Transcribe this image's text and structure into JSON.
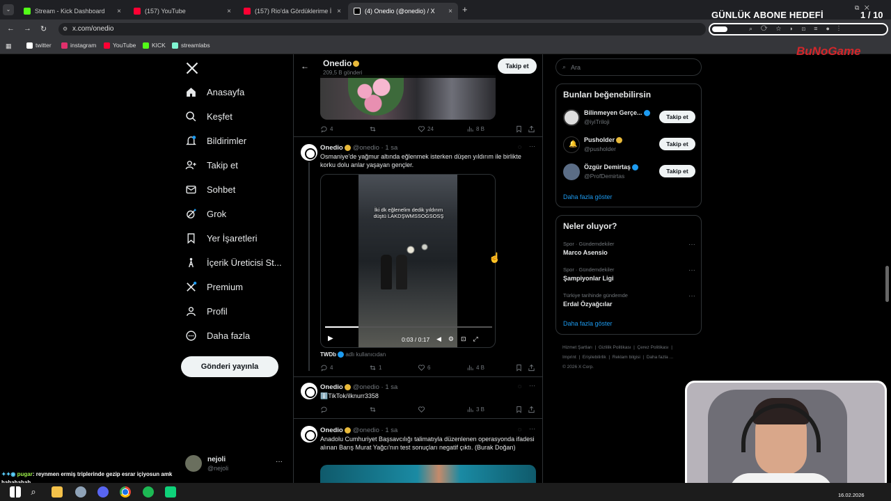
{
  "browser": {
    "tabs": [
      {
        "label": "Stream - Kick Dashboard",
        "color": "#53fc18"
      },
      {
        "label": "(157) YouTube",
        "color": "#ff0033"
      },
      {
        "label": "(157) Rio'da Gördüklerime İnan",
        "color": "#ff0033"
      },
      {
        "label": "(4) Onedio (@onedio) / X",
        "color": "#ffffff"
      }
    ],
    "url": "x.com/onedio",
    "bookmarks": [
      {
        "label": "twitter",
        "color": "#ffffff"
      },
      {
        "label": "instagram",
        "color": "#e1306c"
      },
      {
        "label": "YouTube",
        "color": "#ff0033"
      },
      {
        "label": "KICK",
        "color": "#53fc18"
      },
      {
        "label": "streamlabs",
        "color": "#80f5d2"
      }
    ]
  },
  "overlay": {
    "abone_label": "GÜNLÜK ABONE HEDEFİ",
    "abone_count": "1 / 10",
    "brand": "BuNoGame"
  },
  "leftnav": {
    "items": [
      {
        "label": "Anasayfa",
        "icon": "home-icon"
      },
      {
        "label": "Keşfet",
        "icon": "search-icon"
      },
      {
        "label": "Bildirimler",
        "icon": "bell-icon"
      },
      {
        "label": "Takip et",
        "icon": "follow-icon"
      },
      {
        "label": "Sohbet",
        "icon": "mail-icon"
      },
      {
        "label": "Grok",
        "icon": "grok-icon"
      },
      {
        "label": "Yer İşaretleri",
        "icon": "bookmark-icon"
      },
      {
        "label": "İçerik Üreticisi St...",
        "icon": "creator-icon"
      },
      {
        "label": "Premium",
        "icon": "x-premium-icon"
      },
      {
        "label": "Profil",
        "icon": "person-icon"
      },
      {
        "label": "Daha fazla",
        "icon": "more-circle-icon"
      }
    ],
    "post_button": "Gönderi yayınla",
    "profile_name": "nejoli",
    "profile_handle": "@nejoli"
  },
  "feed": {
    "header_name": "Onedio",
    "header_sub": "209,5 B gönderi",
    "follow_label": "Takip et",
    "top_actions": {
      "reply": "4",
      "like": "24",
      "views": "8 B"
    },
    "tweets": [
      {
        "name": "Onedio",
        "meta": "@onedio · 1 sa",
        "text": "Osmaniye'de yağmur altında eğlenmek isterken düşen yıldırım ile birlikte korku dolu anlar yaşayan gençler.",
        "video_caption": "İki dk eğlenelim dedik yıldırım düştü LAKDŞWMSSOGSOSŞ",
        "video_time": "0:03 / 0:17",
        "credit_name": "TWDb",
        "credit_sub": "adlı kullanıcıdan",
        "reply": "4",
        "retweet": "1",
        "like": "6",
        "views": "4 B"
      },
      {
        "name": "Onedio",
        "meta": "@onedio · 1 sa",
        "text": "ℹ️TikTok/ilknurr3358",
        "reply": "",
        "retweet": "",
        "like": "",
        "views": "3 B"
      },
      {
        "name": "Onedio",
        "meta": "@onedio · 1 sa",
        "text": "Anadolu Cumhuriyet Başsavcılığı talimatıyla düzenlenen operasyonda ifadesi alınan Barış Murat Yağcı'nın test sonuçları negatif çıktı. (Burak Doğan)"
      }
    ]
  },
  "right": {
    "search_placeholder": "Ara",
    "who_title": "Bunları beğenebilirsin",
    "who": [
      {
        "name": "Bilinmeyen Gerçe...",
        "handle": "@iyiTriloji",
        "badge": "blue",
        "follow": "Takip et"
      },
      {
        "name": "Pusholder",
        "handle": "@pusholder",
        "badge": "gold",
        "follow": "Takip et"
      },
      {
        "name": "Özgür Demirtaş",
        "handle": "@ProfDemirtas",
        "badge": "blue",
        "follow": "Takip et"
      }
    ],
    "who_more": "Daha fazla göster",
    "trends_title": "Neler oluyor?",
    "trends": [
      {
        "context": "Spor · Gündemdekiler",
        "title": "Marco Asensio"
      },
      {
        "context": "Spor · Gündemdekiler",
        "title": "Şampiyonlar Ligi"
      },
      {
        "context": "Türkiye tarihinde gündemde",
        "title": "Erdal Özyağcılar"
      }
    ],
    "trends_more": "Daha fazla göster",
    "footer": [
      "Hizmet Şartları",
      "Gizlilik Politikası",
      "Çerez Politikası",
      "Imprint",
      "Erişilebilirlik",
      "Reklam bilgisi",
      "Daha fazla ...",
      "© 2026 X Corp."
    ]
  },
  "chat": {
    "user": "pugar",
    "message": ": reynmen ermiş triplerinde gezip esrar içiyosun amk hahahahah"
  },
  "taskbar": {
    "date": "16.02.2026"
  }
}
